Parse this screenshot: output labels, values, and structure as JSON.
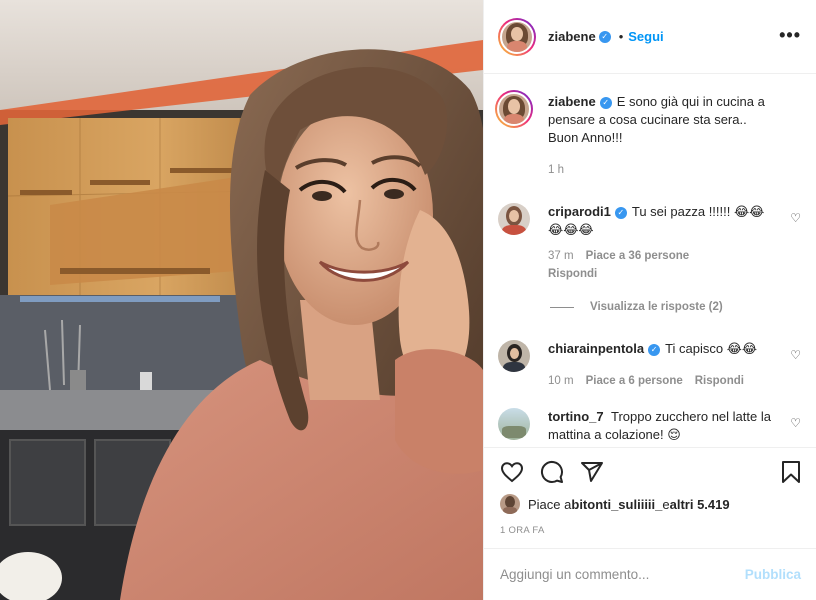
{
  "post": {
    "username": "ziabene",
    "verified_glyph": "✓",
    "separator": "•",
    "follow_label": "Segui",
    "more_glyph": "•••"
  },
  "caption": {
    "username": "ziabene",
    "text": "E sono già qui in cucina a pensare a cosa cucinare sta sera.. Buon Anno!!!",
    "time": "1 h"
  },
  "comments": [
    {
      "username": "criparodi1",
      "verified": true,
      "text": "Tu sei pazza !!!!!! 😂😂😂😂😂",
      "time": "37 m",
      "likes": "Piace a 36 persone",
      "reply": "Rispondi",
      "replies_label": "Visualizza le risposte (2)"
    },
    {
      "username": "chiarainpentola",
      "verified": true,
      "text": "Ti capisco 😂😂",
      "time": "10 m",
      "likes": "Piace a 6 persone",
      "reply": "Rispondi"
    },
    {
      "username": "tortino_7",
      "verified": false,
      "text": "Troppo zucchero nel latte la mattina a colazione! 😌"
    }
  ],
  "likes_bar": {
    "prefix": "Piace a ",
    "user": "bitonti_suliiiii_",
    "middle": " e ",
    "others": "altri 5.419"
  },
  "date": "1 ORA FA",
  "add_comment": {
    "placeholder": "Aggiungi un commento...",
    "publish_label": "Pubblica"
  },
  "colors": {
    "accent": "#0095f6",
    "publish_disabled": "#b2dffc",
    "verified": "#3897f0",
    "muted": "#8e8e8e"
  },
  "icons": [
    "heart-icon",
    "comment-icon",
    "share-icon",
    "bookmark-icon",
    "more-icon",
    "verified-icon"
  ]
}
